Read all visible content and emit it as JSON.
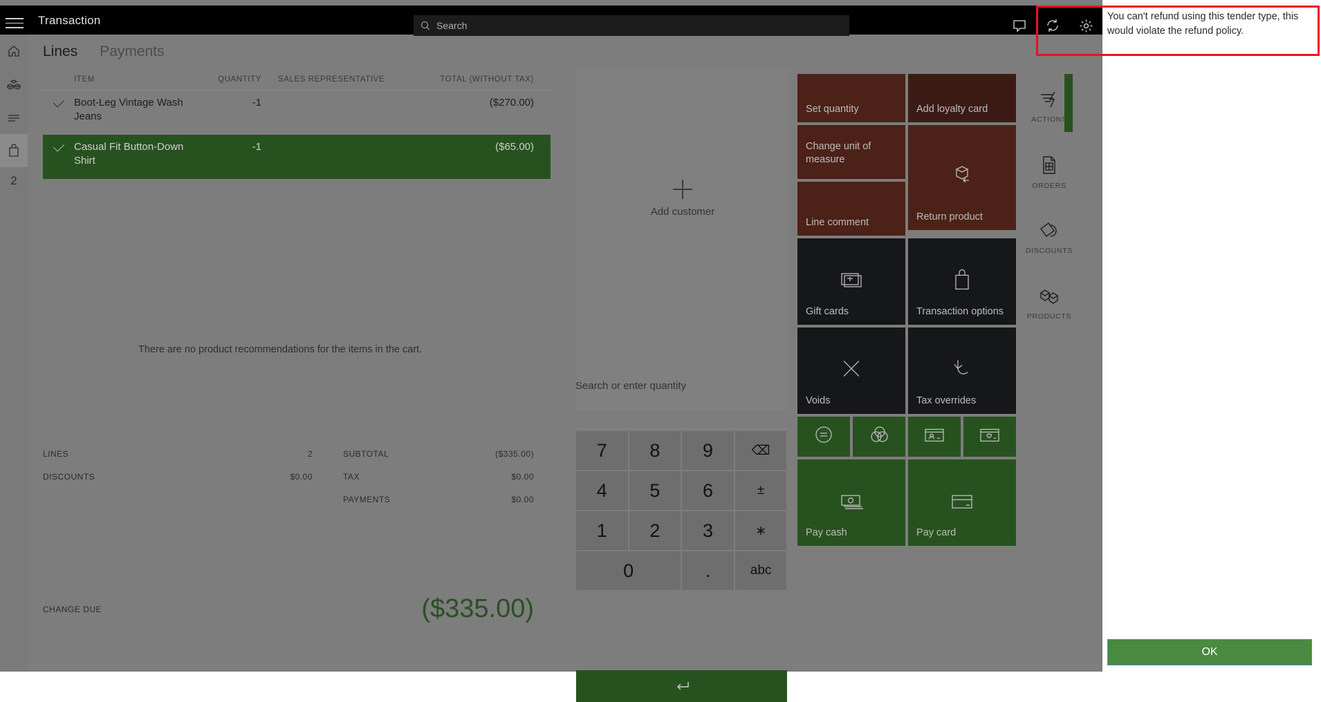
{
  "topbar": {
    "title": "Transaction",
    "search_placeholder": "Search",
    "icons": [
      "feedback-icon",
      "sync-icon",
      "settings-icon"
    ]
  },
  "left_rail": {
    "items": [
      {
        "name": "home",
        "icon": "home-icon"
      },
      {
        "name": "inventory",
        "icon": "boxes-icon"
      },
      {
        "name": "list",
        "icon": "list-icon"
      },
      {
        "name": "cart",
        "icon": "bag-icon",
        "selected": true
      }
    ],
    "count": "2"
  },
  "tabs": [
    {
      "label": "Lines",
      "active": true
    },
    {
      "label": "Payments",
      "active": false
    }
  ],
  "cart": {
    "headers": {
      "item": "ITEM",
      "quantity": "QUANTITY",
      "sales_rep": "SALES REPRESENTATIVE",
      "total": "TOTAL (WITHOUT TAX)"
    },
    "rows": [
      {
        "item": "Boot-Leg Vintage Wash Jeans",
        "quantity": "-1",
        "sales_rep": "",
        "total": "($270.00)",
        "selected": false
      },
      {
        "item": "Casual Fit Button-Down Shirt",
        "quantity": "-1",
        "sales_rep": "",
        "total": "($65.00)",
        "selected": true
      }
    ],
    "no_recommendations": "There are no product recommendations for the items in the cart."
  },
  "totals": {
    "lines_label": "LINES",
    "lines_value": "2",
    "discounts_label": "DISCOUNTS",
    "discounts_value": "$0.00",
    "subtotal_label": "SUBTOTAL",
    "subtotal_value": "($335.00)",
    "tax_label": "TAX",
    "tax_value": "$0.00",
    "payments_label": "PAYMENTS",
    "payments_value": "$0.00",
    "change_due_label": "CHANGE DUE",
    "change_due_value": "($335.00)"
  },
  "customer": {
    "add_label": "Add customer"
  },
  "keypad": {
    "search_hint": "Search or enter quantity",
    "keys": [
      "7",
      "8",
      "9",
      "⌫",
      "4",
      "5",
      "6",
      "±",
      "1",
      "2",
      "3",
      "∗",
      "0",
      ".",
      "abc"
    ],
    "enter_icon": "enter-icon"
  },
  "tiles": [
    {
      "label": "Set quantity",
      "color": "#4b2118",
      "icon": ""
    },
    {
      "label": "Add loyalty card",
      "color": "#3b1b14",
      "icon": ""
    },
    {
      "label": "Change unit of measure",
      "color": "#4b2118",
      "icon": ""
    },
    {
      "label": "Return product",
      "color": "#4b2118",
      "icon": "return-product-icon"
    },
    {
      "label": "Line comment",
      "color": "#4b2118",
      "icon": ""
    },
    {
      "label": "Gift cards",
      "color": "#161719",
      "icon": "gift-card-icon"
    },
    {
      "label": "Transaction options",
      "color": "#161719",
      "icon": "bag-icon"
    },
    {
      "label": "Voids",
      "color": "#161719",
      "icon": "close-icon"
    },
    {
      "label": "Tax overrides",
      "color": "#161719",
      "icon": "undo-icon"
    },
    {
      "label": "",
      "color": "#27521f",
      "icon": "equals-circle-icon"
    },
    {
      "label": "",
      "color": "#27521f",
      "icon": "currency-icon"
    },
    {
      "label": "",
      "color": "#27521f",
      "icon": "id-card-icon"
    },
    {
      "label": "",
      "color": "#27521f",
      "icon": "loyalty-card-icon"
    },
    {
      "label": "Pay cash",
      "color": "#27521f",
      "icon": "cash-icon"
    },
    {
      "label": "Pay card",
      "color": "#27521f",
      "icon": "credit-card-icon"
    }
  ],
  "right_rail": [
    {
      "label": "ACTIONS",
      "icon": "actions-icon"
    },
    {
      "label": "ORDERS",
      "icon": "orders-icon"
    },
    {
      "label": "DISCOUNTS",
      "icon": "discount-tag-icon"
    },
    {
      "label": "PRODUCTS",
      "icon": "products-icon"
    }
  ],
  "dialog": {
    "message": "You can't refund using this tender type, this would violate the refund policy.",
    "ok_label": "OK",
    "highlight_color": "#e81123",
    "ok_color": "#4a8a40"
  }
}
